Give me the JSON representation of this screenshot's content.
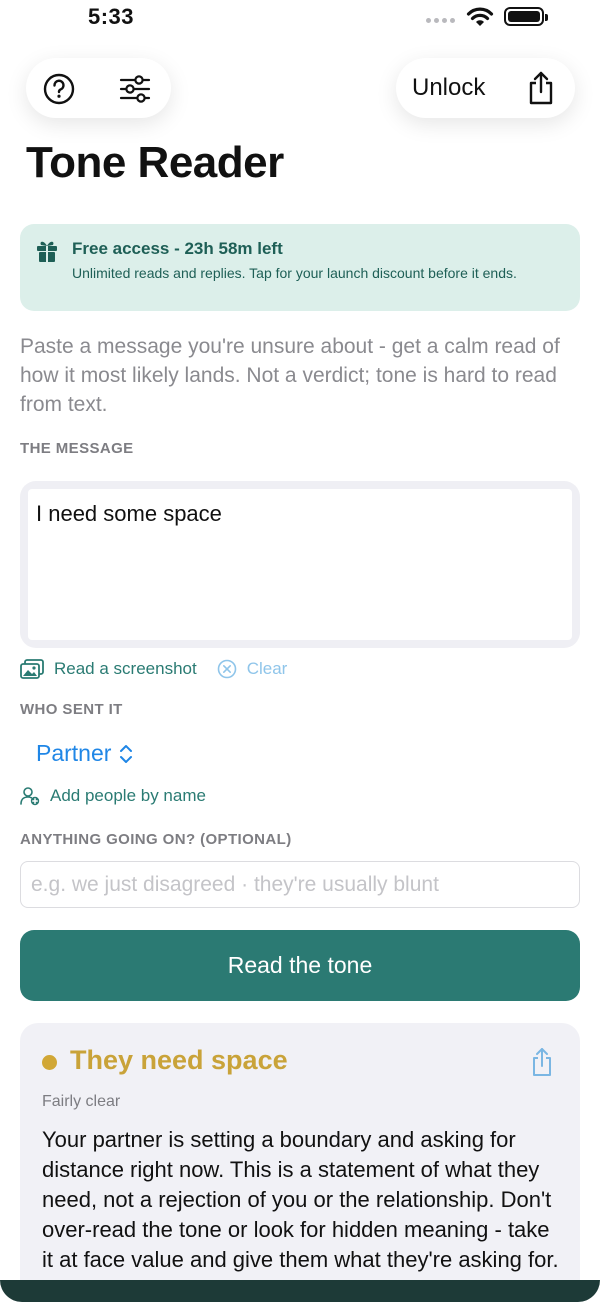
{
  "status": {
    "time": "5:33"
  },
  "toolbar": {
    "unlock_label": "Unlock"
  },
  "page": {
    "title": "Tone Reader"
  },
  "banner": {
    "title": "Free access - 23h 58m left",
    "body": "Unlimited reads and replies. Tap for your launch discount before it ends."
  },
  "intro": "Paste a message you're unsure about - get a calm read of how it most likely lands. Not a verdict; tone is hard to read from text.",
  "message": {
    "label": "THE MESSAGE",
    "value": "I need some space",
    "read_screenshot_label": "Read a screenshot",
    "clear_label": "Clear"
  },
  "sender": {
    "label": "WHO SENT IT",
    "selected": "Partner",
    "add_people_label": "Add people by name"
  },
  "context": {
    "label": "ANYTHING GOING ON?  (OPTIONAL)",
    "placeholder": "e.g. we just disagreed · they're usually blunt"
  },
  "primary_button": "Read the tone",
  "result": {
    "title": "They need space",
    "confidence": "Fairly clear",
    "body": "Your partner is setting a boundary and asking for distance right now. This is a statement of what they need, not a rejection of you or the relationship. Don't over-read the tone or look for hidden meaning - take it at face value and give them what they're asking for."
  },
  "colors": {
    "accent_teal": "#2b7a73",
    "banner_bg": "#dcefea",
    "link_blue": "#1f86e6",
    "result_gold": "#c9a339"
  },
  "icons": [
    "help-icon",
    "sliders-icon",
    "share-icon",
    "gift-icon",
    "photo-icon",
    "clear-circle-icon",
    "chevron-updown-icon",
    "person-add-icon"
  ]
}
